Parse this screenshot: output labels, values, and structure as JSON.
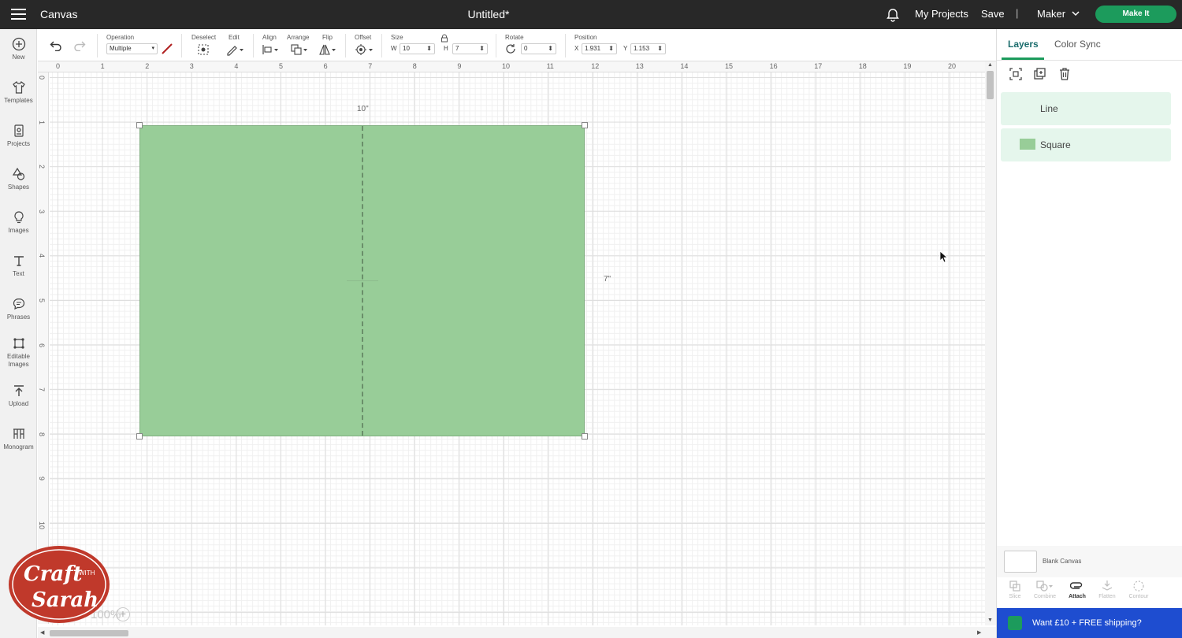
{
  "topbar": {
    "app_name": "Canvas",
    "doc_title": "Untitled*",
    "my_projects": "My Projects",
    "save": "Save",
    "separator": "|",
    "machine": "Maker",
    "make_it": "Make It"
  },
  "sidebar": {
    "items": [
      {
        "label": "New",
        "icon": "plus-circle-icon"
      },
      {
        "label": "Templates",
        "icon": "shirt-icon"
      },
      {
        "label": "Projects",
        "icon": "projects-icon"
      },
      {
        "label": "Shapes",
        "icon": "shapes-icon"
      },
      {
        "label": "Images",
        "icon": "lightbulb-icon"
      },
      {
        "label": "Text",
        "icon": "text-icon"
      },
      {
        "label": "Phrases",
        "icon": "speech-bubble-icon"
      },
      {
        "label": "Editable Images",
        "icon": "editable-images-icon"
      },
      {
        "label": "Upload",
        "icon": "upload-icon"
      },
      {
        "label": "Monogram",
        "icon": "monogram-icon"
      }
    ]
  },
  "toolbar": {
    "operation_label": "Operation",
    "operation_value": "Multiple",
    "deselect_label": "Deselect",
    "edit_label": "Edit",
    "align_label": "Align",
    "arrange_label": "Arrange",
    "flip_label": "Flip",
    "offset_label": "Offset",
    "size_label": "Size",
    "w_letter": "W",
    "w_value": "10",
    "h_letter": "H",
    "h_value": "7",
    "rotate_label": "Rotate",
    "rotate_value": "0",
    "position_label": "Position",
    "x_letter": "X",
    "x_value": "1.931",
    "y_letter": "Y",
    "y_value": "1.153"
  },
  "ruler": {
    "top": [
      "0",
      "1",
      "2",
      "3",
      "4",
      "5",
      "6",
      "7",
      "8",
      "9",
      "10",
      "11",
      "12",
      "13",
      "14",
      "15",
      "16",
      "17",
      "18",
      "19",
      "20"
    ],
    "left": [
      "0",
      "1",
      "2",
      "3",
      "4",
      "5",
      "6",
      "7",
      "8",
      "9",
      "10"
    ]
  },
  "canvas": {
    "width_label": "10\"",
    "height_label": "7\"",
    "shape_color": "#98cd98",
    "zoom": "100%"
  },
  "right_panel": {
    "tabs": [
      "Layers",
      "Color Sync"
    ],
    "active_tab": "Layers",
    "layers": [
      {
        "name": "Line"
      },
      {
        "name": "Square"
      }
    ],
    "blank_canvas": "Blank Canvas",
    "bottom_tools": [
      {
        "label": "Slice",
        "enabled": false
      },
      {
        "label": "Combine",
        "enabled": false
      },
      {
        "label": "Attach",
        "enabled": true
      },
      {
        "label": "Flatten",
        "enabled": false
      },
      {
        "label": "Contour",
        "enabled": false
      }
    ],
    "promo": "Want £10 + FREE shipping?"
  },
  "colors": {
    "accent": "#1c9b5c",
    "topbar": "#282828",
    "promo": "#1e4dd0"
  },
  "logo": {
    "line1": "Craft",
    "line2": "WITH",
    "line3": "Sarah"
  }
}
